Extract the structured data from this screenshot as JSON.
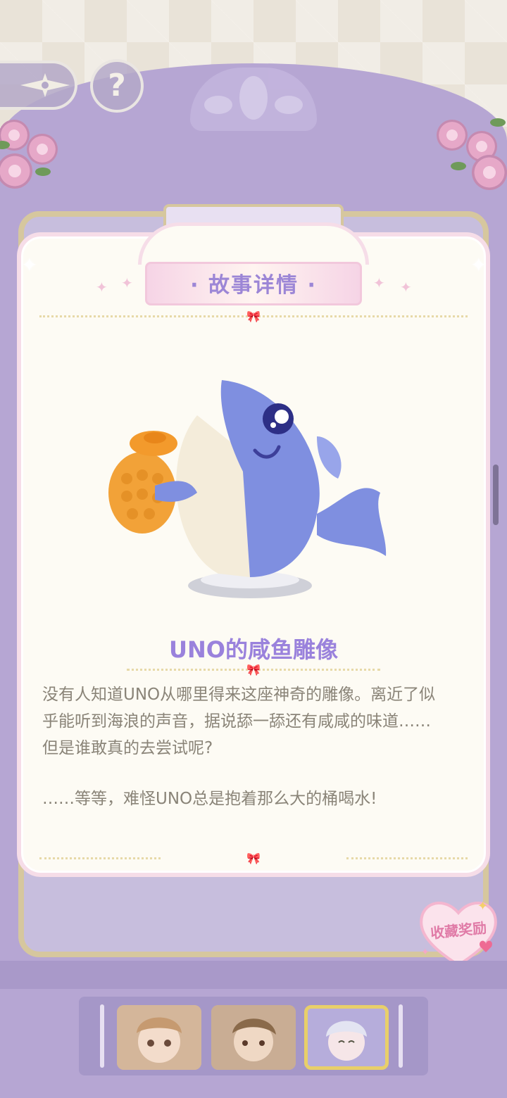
{
  "header": {
    "help_symbol": "?",
    "back_icon": "compass-arrow-icon"
  },
  "card": {
    "title": "故事详情",
    "title_decor_left": "·",
    "title_decor_right": "·",
    "item_name": "UNO的咸鱼雕像",
    "description": [
      "没有人知道UNO从哪里得来这座神奇的雕像。离近了似",
      "乎能听到海浪的声音，据说舔一舔还有咸咸的味道……",
      "但是谁敢真的去尝试呢?",
      "",
      "……等等，难怪UNO总是抱着那么大的桶喝水!"
    ]
  },
  "reward_button": {
    "label": "收藏奖励"
  },
  "portraits": [
    {
      "name": "character-girl-portrait",
      "selected": false
    },
    {
      "name": "character-boy-portrait",
      "selected": false
    },
    {
      "name": "character-uno-portrait",
      "selected": true
    }
  ],
  "colors": {
    "title_purple": "#9c86d6",
    "name_purple": "#9a82dc",
    "card_border_pink": "#f6dde8",
    "frame_gold": "#d6c79e",
    "wardrobe_lilac": "#b6a6d3"
  }
}
